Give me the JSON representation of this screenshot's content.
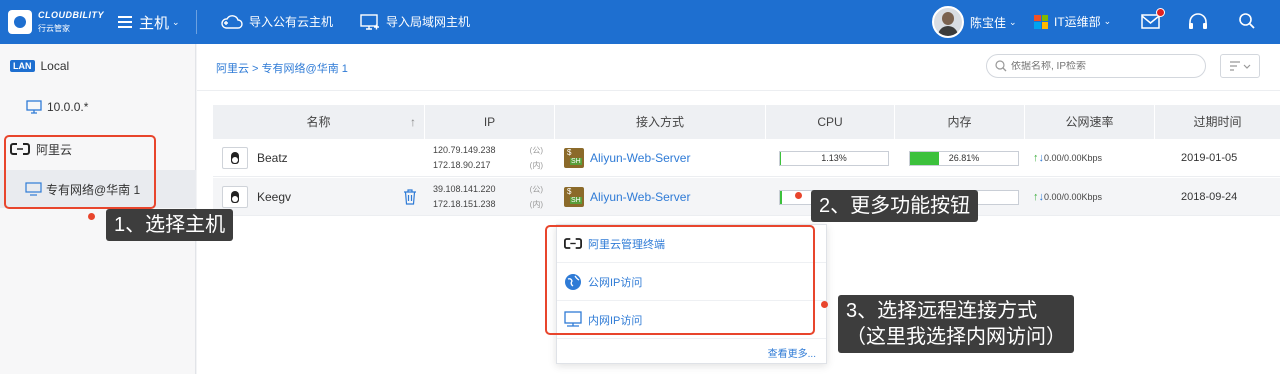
{
  "topbar": {
    "logo_line1": "CLOUDBILITY",
    "logo_line2": "行云管家",
    "menu_label": "主机",
    "import_public": "导入公有云主机",
    "import_lan": "导入局域网主机",
    "user_name": "陈宝佳",
    "department": "IT运维部"
  },
  "sidebar": {
    "lan_badge": "LAN",
    "lan_label": "Local",
    "lan_host": "10.0.0.*",
    "cloud_label": "阿里云",
    "vpc_label": "专有网络@华南 1"
  },
  "main": {
    "breadcrumb": "阿里云 > 专有网络@华南 1",
    "search_placeholder": "依据名称, IP检索"
  },
  "table": {
    "headers": [
      "名称",
      "IP",
      "接入方式",
      "CPU",
      "内存",
      "公网速率",
      "过期时间"
    ],
    "sort_icon": "↑",
    "rows": [
      {
        "name": "Beatz",
        "ip_public": "120.79.149.238",
        "ip_public_label": "(公)",
        "ip_private": "172.18.90.217",
        "ip_private_label": "(内)",
        "access": "Aliyun-Web-Server",
        "cpu": "1.13%",
        "cpu_value": 1.13,
        "mem": "26.81%",
        "mem_value": 26.81,
        "net": "0.00/0.00Kbps",
        "expire": "2019-01-05"
      },
      {
        "name": "Keegv",
        "ip_public": "39.108.141.220",
        "ip_public_label": "(公)",
        "ip_private": "172.18.151.238",
        "ip_private_label": "(内)",
        "access": "Aliyun-Web-Server",
        "cpu": "1.96%",
        "cpu_value": 1.96,
        "mem": "",
        "mem_value": 20,
        "net": "0.00/0.00Kbps",
        "expire": "2018-09-24"
      }
    ]
  },
  "dropdown": {
    "items": [
      "阿里云管理终端",
      "公网IP访问",
      "内网IP访问"
    ],
    "more": "查看更多..."
  },
  "annotations": {
    "step1": "1、选择主机",
    "step2": "2、更多功能按钮",
    "step3": "3、选择远程连接方式\n（这里我选择内网访问）"
  },
  "colors": {
    "brand": "#1e6fd0",
    "link": "#2f7bd6",
    "bar_fill": "#3cc13c",
    "annotation_red": "#e8452c"
  }
}
